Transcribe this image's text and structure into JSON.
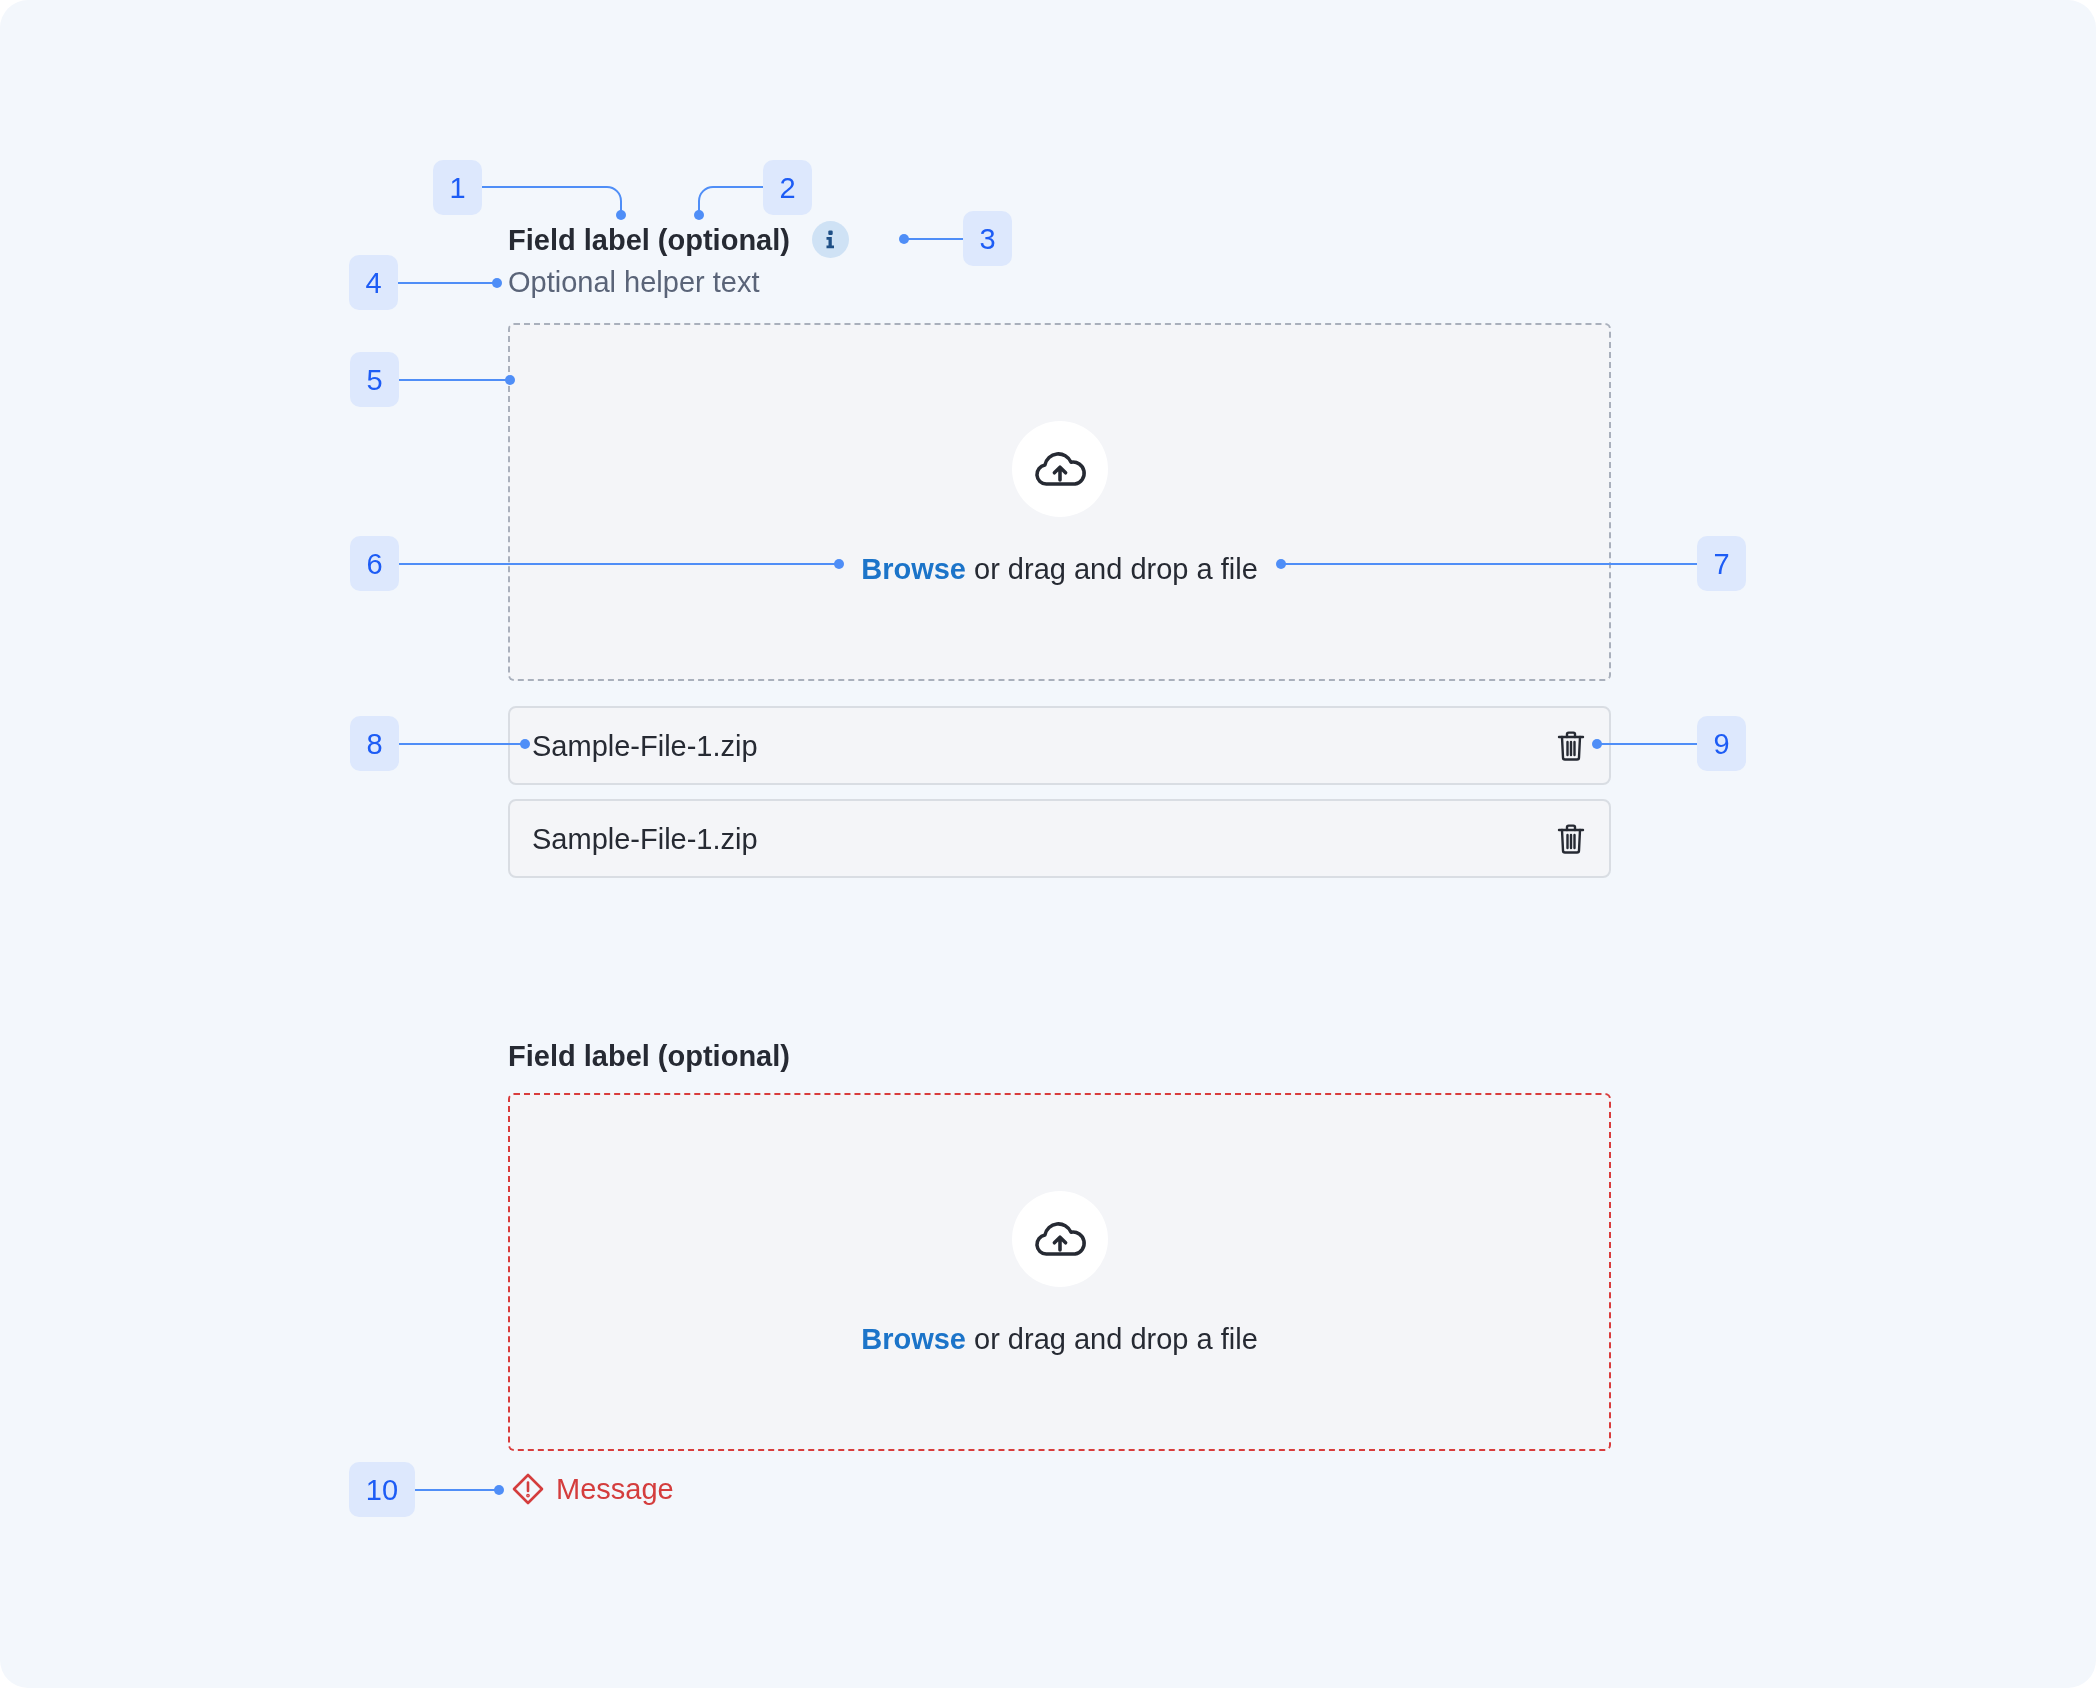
{
  "sections": [
    {
      "label": "Field label (optional)",
      "info": true,
      "helper": "Optional helper text",
      "dropzone": {
        "invalid": false,
        "link": "Browse",
        "text": "or drag and drop a file"
      },
      "files": [
        {
          "name": "Sample-File-1.zip"
        },
        {
          "name": "Sample-File-1.zip"
        }
      ]
    },
    {
      "label": "Field label (optional)",
      "dropzone": {
        "invalid": true,
        "link": "Browse",
        "text": "or drag and drop a file"
      },
      "error": "Message"
    }
  ],
  "annotations": [
    "1",
    "2",
    "3",
    "4",
    "5",
    "6",
    "7",
    "8",
    "9",
    "10"
  ]
}
